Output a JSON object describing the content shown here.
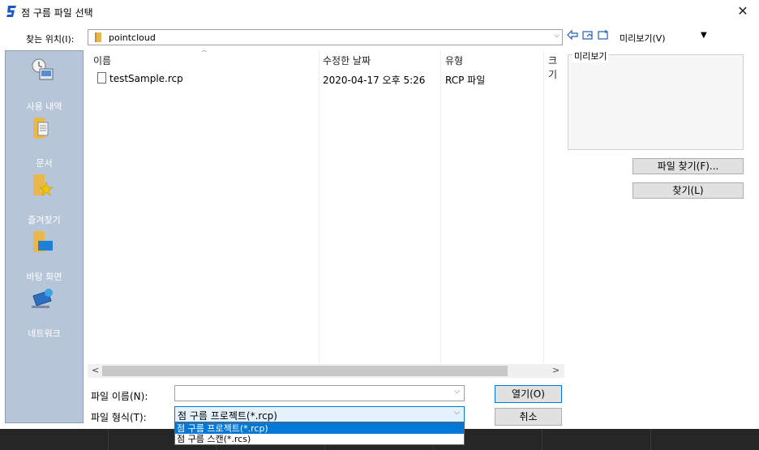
{
  "window": {
    "title": "점 구름 파일 선택",
    "close_glyph": "✕"
  },
  "lookin": {
    "label": "찾는 위치(I):",
    "value": "pointcloud",
    "arrow": "⌵"
  },
  "toolbar": {
    "preview_label": "미리보기(V)",
    "preview_arrow": "▼",
    "icons": [
      "back-icon",
      "up-folder-icon",
      "new-folder-icon"
    ]
  },
  "places": [
    {
      "label": "사용 내역",
      "icon": "history-icon"
    },
    {
      "label": "문서",
      "icon": "documents-icon"
    },
    {
      "label": "즐겨찾기",
      "icon": "favorites-icon"
    },
    {
      "label": "바탕 화면",
      "icon": "desktop-icon"
    },
    {
      "label": "네트워크",
      "icon": "network-icon"
    }
  ],
  "columns": {
    "name": "이름",
    "date": "수정한 날짜",
    "type": "유형",
    "size": "크기"
  },
  "files": [
    {
      "name": "testSample.rcp",
      "date": "2020-04-17 오후 5:26",
      "type": "RCP 파일"
    }
  ],
  "preview": {
    "group_label": "미리보기"
  },
  "side_buttons": {
    "find_file": "파일 찾기(F)...",
    "find": "찾기(L)"
  },
  "form": {
    "filename_label": "파일 이름(N):",
    "filename_value": "",
    "filetype_label": "파일 형식(T):",
    "filetype_value": "점 구름 프로젝트(*.rcp)",
    "filetype_options": [
      "점 구름 프로젝트(*.rcp)",
      "점 구름 스캔(*.rcs)"
    ],
    "open_label": "열기(O)",
    "cancel_label": "취소"
  },
  "scroll": {
    "left_arrow": "<",
    "right_arrow": ">"
  },
  "colors": {
    "accent": "#0078d7",
    "places_bg": "#b6c6d8"
  }
}
